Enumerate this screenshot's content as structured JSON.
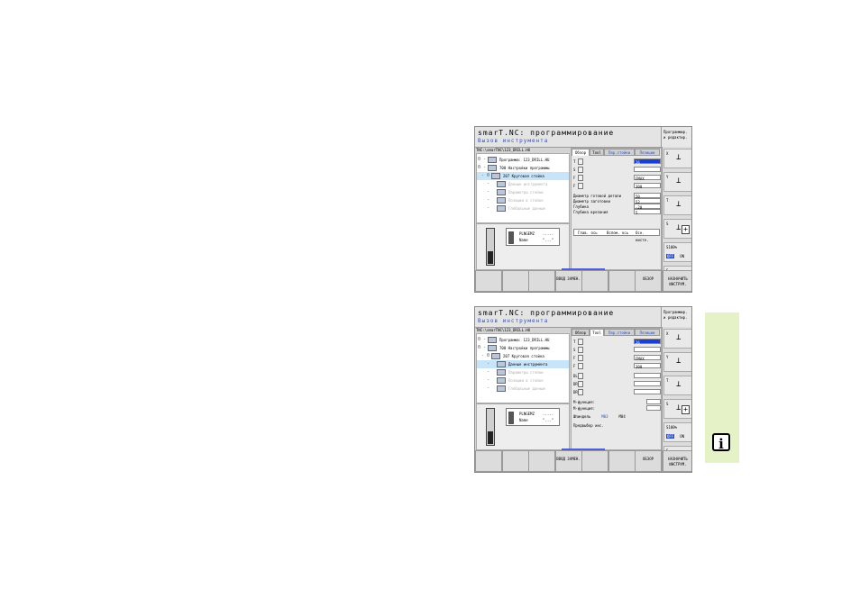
{
  "screens": [
    {
      "title": "smarT.NC: программирование",
      "subtitle": "Вызов инструмента",
      "mode": [
        "Программир.",
        "и редактир."
      ],
      "path": "TNC:\\smarTNC\\123_DRILL.HU",
      "tree": [
        {
          "lead": "0 -",
          "label": "Программа: 123_DRILL.HU",
          "dim": false,
          "sel": false
        },
        {
          "lead": "0 -",
          "label": "700 Настройки программы",
          "dim": false,
          "sel": false
        },
        {
          "lead": "- 0",
          "label": "207 Круговая стойка",
          "dim": false,
          "sel": true
        },
        {
          "lead": "-",
          "label": "Данные инструмента",
          "dim": true,
          "sel": false
        },
        {
          "lead": "-",
          "label": "Параметры стойки",
          "dim": true,
          "sel": false
        },
        {
          "lead": "-",
          "label": "Позиции в стойке",
          "dim": true,
          "sel": false
        },
        {
          "lead": "-",
          "label": "Глобальные данные",
          "dim": true,
          "sel": false
        }
      ],
      "preview": {
        "name_label": "PLNGEMZ",
        "name_value": ".....",
        "num_label": "Name",
        "num_value": "\"...\""
      },
      "tabs": [
        "Обзор",
        "Tool",
        "Пар.стойки",
        "Позиции"
      ],
      "fields": [
        {
          "label": "T",
          "value": "26",
          "blue": true
        },
        {
          "label": "S",
          "value": "",
          "blue": false
        },
        {
          "label": "F",
          "value": "FMAX",
          "blue": false
        },
        {
          "label": "F",
          "value": "300",
          "blue": false
        }
      ],
      "params": [
        {
          "label": "Диаметр готовой детали",
          "value": "50"
        },
        {
          "label": "Диаметр заготовки",
          "value": "52"
        },
        {
          "label": "Глубина",
          "value": "-20"
        },
        {
          "label": "Глубина врезания",
          "value": "5"
        }
      ],
      "table_header": [
        "Глав. ось",
        "Вспом. ось",
        "Осн. кисте."
      ],
      "softkeys": [
        "",
        "",
        "",
        "ВВОД ЗАМЕН.",
        "",
        "",
        "ОБЗОР",
        "НАЗНАЧИТЬ ИНСТРУМ."
      ],
      "rightbar": [
        "X",
        "Y",
        "T",
        "S",
        "S100%",
        "S"
      ],
      "onoff": {
        "off": "OFF",
        "on": "ON"
      }
    },
    {
      "title": "smarT.NC: программирование",
      "subtitle": "Вызов инструмента",
      "mode": [
        "Программир.",
        "и редактир."
      ],
      "path": "TNC:\\smarTNC\\123_DRILL.HU",
      "tree": [
        {
          "lead": "0 -",
          "label": "Программа: 123_DRILL.HU",
          "dim": false,
          "sel": false
        },
        {
          "lead": "0 -",
          "label": "700 Настройки программы",
          "dim": false,
          "sel": false
        },
        {
          "lead": "- 0",
          "label": "207 Круговая стойка",
          "dim": false,
          "sel": false
        },
        {
          "lead": "-",
          "label": "Данные инструмента",
          "dim": false,
          "sel": true
        },
        {
          "lead": "-",
          "label": "Параметры стойки",
          "dim": true,
          "sel": false
        },
        {
          "lead": "-",
          "label": "Позиции в стойке",
          "dim": true,
          "sel": false
        },
        {
          "lead": "-",
          "label": "Глобальные данные",
          "dim": true,
          "sel": false
        }
      ],
      "preview": {
        "name_label": "PLNGEMZ",
        "name_value": ".....",
        "num_label": "Name",
        "num_value": "\"...\""
      },
      "tabs": [
        "Обзор",
        "Tool",
        "Пар.стойки",
        "Позиции"
      ],
      "fields": [
        {
          "label": "T",
          "value": "26",
          "blue": true
        },
        {
          "label": "S",
          "value": "",
          "blue": false
        },
        {
          "label": "F",
          "value": "FMAX",
          "blue": false
        },
        {
          "label": "F",
          "value": "300",
          "blue": false
        },
        {
          "label": "DL",
          "value": "",
          "blue": false
        },
        {
          "label": "DR",
          "value": "",
          "blue": false
        },
        {
          "label": "DR2",
          "value": "",
          "blue": false
        }
      ],
      "misc": [
        "M-функция:",
        "M-функция:"
      ],
      "spindle": {
        "label": "Шпиндель",
        "m3": "M03",
        "m4": "M04"
      },
      "preselect": "Предвыбор инс.",
      "softkeys": [
        "",
        "",
        "",
        "ВВОД ЗАМЕН.",
        "",
        "",
        "ОБЗОР",
        "НАЗНАЧИТЬ ИНСТРУМ."
      ],
      "rightbar": [
        "X",
        "Y",
        "T",
        "S",
        "S100%",
        "S"
      ],
      "onoff": {
        "off": "OFF",
        "on": "ON"
      }
    }
  ],
  "info_symbol": "i"
}
